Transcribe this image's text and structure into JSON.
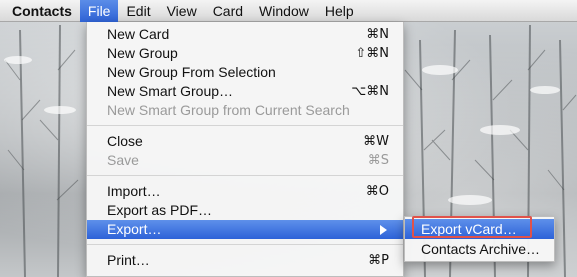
{
  "menubar": {
    "app": "Contacts",
    "items": [
      "File",
      "Edit",
      "View",
      "Card",
      "Window",
      "Help"
    ]
  },
  "file_menu": {
    "items": [
      {
        "label": "New Card",
        "shortcut": "⌘N",
        "enabled": true
      },
      {
        "label": "New Group",
        "shortcut": "⇧⌘N",
        "enabled": true
      },
      {
        "label": "New Group From Selection",
        "shortcut": "",
        "enabled": true
      },
      {
        "label": "New Smart Group…",
        "shortcut": "⌥⌘N",
        "enabled": true
      },
      {
        "label": "New Smart Group from Current Search",
        "shortcut": "",
        "enabled": false
      },
      {
        "label": "Close",
        "shortcut": "⌘W",
        "enabled": true
      },
      {
        "label": "Save",
        "shortcut": "⌘S",
        "enabled": false
      },
      {
        "label": "Import…",
        "shortcut": "⌘O",
        "enabled": true
      },
      {
        "label": "Export as PDF…",
        "shortcut": "",
        "enabled": true
      },
      {
        "label": "Export…",
        "shortcut": "",
        "enabled": true,
        "highlighted": true
      },
      {
        "label": "Print…",
        "shortcut": "⌘P",
        "enabled": true
      }
    ]
  },
  "export_submenu": {
    "items": [
      {
        "label": "Export vCard…",
        "highlighted": true
      },
      {
        "label": "Contacts Archive…",
        "highlighted": false
      }
    ]
  },
  "colors": {
    "highlight": "#2d62d8",
    "annotation_box": "#e0524a"
  }
}
